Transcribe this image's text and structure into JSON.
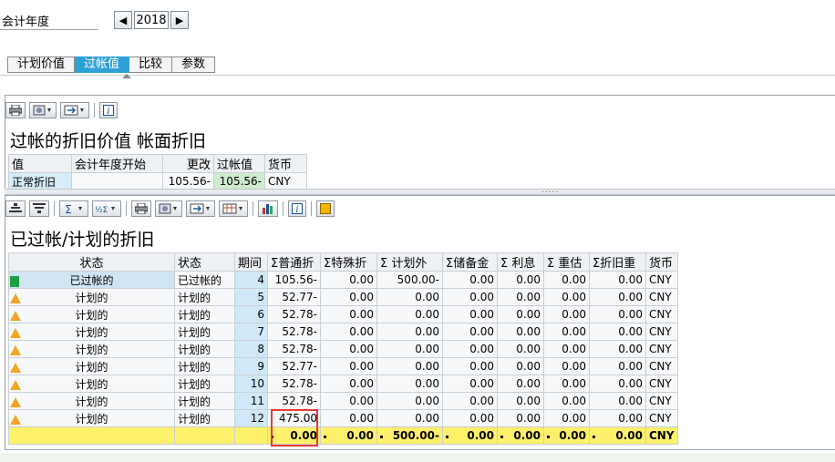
{
  "fiscal_year": {
    "label": "会计年度",
    "value": "2018",
    "prev_icon": "triangle-left-icon",
    "next_icon": "triangle-right-icon"
  },
  "tabs": [
    {
      "label": "计划价值",
      "active": false
    },
    {
      "label": "过帐值",
      "active": true
    },
    {
      "label": "比较",
      "active": false
    },
    {
      "label": "参数",
      "active": false
    }
  ],
  "top_panel": {
    "title": "过帐的折旧价值 帐面折旧",
    "headers": [
      "值",
      "会计年度开始",
      "更改",
      "过帐值",
      "货币"
    ],
    "row": [
      "正常折旧",
      "",
      "105.56-",
      "105.56-",
      "CNY"
    ]
  },
  "splitter": {
    "dots": "....."
  },
  "bottom_panel": {
    "title": "已过帐/计划的折旧",
    "headers": [
      "状态",
      "状态",
      "期间",
      "Σ普通折",
      "Σ特殊折",
      "Σ 计划外",
      "Σ储备金",
      "Σ 利息",
      "Σ 重估",
      "Σ折旧重",
      "货币"
    ],
    "rows": [
      {
        "icon": "green-square-icon",
        "status1": "已过帐的",
        "status2": "已过帐的",
        "period": "4",
        "ordinary": "105.56-",
        "special": "0.00",
        "unplanned": "500.00-",
        "reserve": "0.00",
        "interest": "0.00",
        "revaluation": "0.00",
        "dep_reval": "0.00",
        "currency": "CNY"
      },
      {
        "icon": "warning-triangle-icon",
        "status1": "计划的",
        "status2": "计划的",
        "period": "5",
        "ordinary": "52.77-",
        "special": "0.00",
        "unplanned": "0.00",
        "reserve": "0.00",
        "interest": "0.00",
        "revaluation": "0.00",
        "dep_reval": "0.00",
        "currency": "CNY"
      },
      {
        "icon": "warning-triangle-icon",
        "status1": "计划的",
        "status2": "计划的",
        "period": "6",
        "ordinary": "52.78-",
        "special": "0.00",
        "unplanned": "0.00",
        "reserve": "0.00",
        "interest": "0.00",
        "revaluation": "0.00",
        "dep_reval": "0.00",
        "currency": "CNY"
      },
      {
        "icon": "warning-triangle-icon",
        "status1": "计划的",
        "status2": "计划的",
        "period": "7",
        "ordinary": "52.78-",
        "special": "0.00",
        "unplanned": "0.00",
        "reserve": "0.00",
        "interest": "0.00",
        "revaluation": "0.00",
        "dep_reval": "0.00",
        "currency": "CNY"
      },
      {
        "icon": "warning-triangle-icon",
        "status1": "计划的",
        "status2": "计划的",
        "period": "8",
        "ordinary": "52.78-",
        "special": "0.00",
        "unplanned": "0.00",
        "reserve": "0.00",
        "interest": "0.00",
        "revaluation": "0.00",
        "dep_reval": "0.00",
        "currency": "CNY"
      },
      {
        "icon": "warning-triangle-icon",
        "status1": "计划的",
        "status2": "计划的",
        "period": "9",
        "ordinary": "52.77-",
        "special": "0.00",
        "unplanned": "0.00",
        "reserve": "0.00",
        "interest": "0.00",
        "revaluation": "0.00",
        "dep_reval": "0.00",
        "currency": "CNY"
      },
      {
        "icon": "warning-triangle-icon",
        "status1": "计划的",
        "status2": "计划的",
        "period": "10",
        "ordinary": "52.78-",
        "special": "0.00",
        "unplanned": "0.00",
        "reserve": "0.00",
        "interest": "0.00",
        "revaluation": "0.00",
        "dep_reval": "0.00",
        "currency": "CNY"
      },
      {
        "icon": "warning-triangle-icon",
        "status1": "计划的",
        "status2": "计划的",
        "period": "11",
        "ordinary": "52.78-",
        "special": "0.00",
        "unplanned": "0.00",
        "reserve": "0.00",
        "interest": "0.00",
        "revaluation": "0.00",
        "dep_reval": "0.00",
        "currency": "CNY"
      },
      {
        "icon": "warning-triangle-icon",
        "status1": "计划的",
        "status2": "计划的",
        "period": "12",
        "ordinary": "475.00",
        "special": "0.00",
        "unplanned": "0.00",
        "reserve": "0.00",
        "interest": "0.00",
        "revaluation": "0.00",
        "dep_reval": "0.00",
        "currency": "CNY"
      }
    ],
    "totals": {
      "ordinary": "0.00",
      "special": "0.00",
      "unplanned": "500.00-",
      "reserve": "0.00",
      "interest": "0.00",
      "revaluation": "0.00",
      "dep_reval": "0.00",
      "currency": "CNY"
    },
    "highlight_color": "#e53935"
  },
  "toolbar_icons": {
    "top": [
      "print-icon",
      "export-icon",
      "layout-icon",
      "info-icon"
    ],
    "bottom": [
      "sort-ascending-icon",
      "filter-icon",
      "sum-icon",
      "subtotal-icon",
      "print-icon",
      "export-icon",
      "layout-icon",
      "columns-icon",
      "chart-icon",
      "info-icon",
      "note-icon"
    ]
  },
  "colors": {
    "tab_active": "#2ea0d8",
    "total_row": "#fdf06a",
    "posted": "#1e9e46",
    "planned": "#f2a623"
  }
}
